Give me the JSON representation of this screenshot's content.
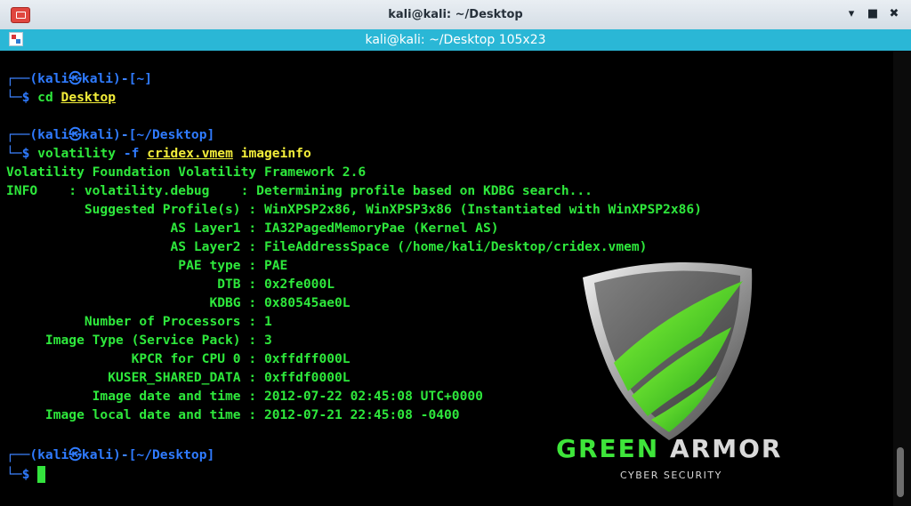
{
  "window": {
    "title": "kali@kali: ~/Desktop",
    "minimize_icon": "minimize-icon",
    "maximize_icon": "maximize-icon",
    "close_icon": "close-icon"
  },
  "tab": {
    "title": "kali@kali: ~/Desktop 105x23"
  },
  "terminal": {
    "prompt1": {
      "user": "(kali",
      "at": "㉿",
      "host": "kali)",
      "dir": "[~]",
      "cmd": "cd",
      "arg": "Desktop"
    },
    "prompt2": {
      "user": "(kali",
      "at": "㉿",
      "host": "kali)",
      "dir": "[~/Desktop]",
      "cmd": "volatility",
      "flag": "-f",
      "file": "cridex.vmem",
      "arg": "imageinfo"
    },
    "output": [
      "Volatility Foundation Volatility Framework 2.6",
      "INFO    : volatility.debug    : Determining profile based on KDBG search...",
      "          Suggested Profile(s) : WinXPSP2x86, WinXPSP3x86 (Instantiated with WinXPSP2x86)",
      "                     AS Layer1 : IA32PagedMemoryPae (Kernel AS)",
      "                     AS Layer2 : FileAddressSpace (/home/kali/Desktop/cridex.vmem)",
      "                      PAE type : PAE",
      "                           DTB : 0x2fe000L",
      "                          KDBG : 0x80545ae0L",
      "          Number of Processors : 1",
      "     Image Type (Service Pack) : 3",
      "                KPCR for CPU 0 : 0xffdff000L",
      "             KUSER_SHARED_DATA : 0xffdf0000L",
      "           Image date and time : 2012-07-22 02:45:08 UTC+0000",
      "     Image local date and time : 2012-07-21 22:45:08 -0400"
    ],
    "prompt3": {
      "user": "(kali",
      "at": "㉿",
      "host": "kali)",
      "dir": "[~/Desktop]"
    }
  },
  "watermark": {
    "name_part1": "GREEN",
    "name_part2": "ARMOR",
    "tagline": "CYBER SECURITY"
  },
  "colors": {
    "prompt_blue": "#2f7bff",
    "output_green": "#2ee83c",
    "command_yellow": "#f3ee3a",
    "tab_bar": "#2ab7d6",
    "close_red": "#e0463f"
  }
}
